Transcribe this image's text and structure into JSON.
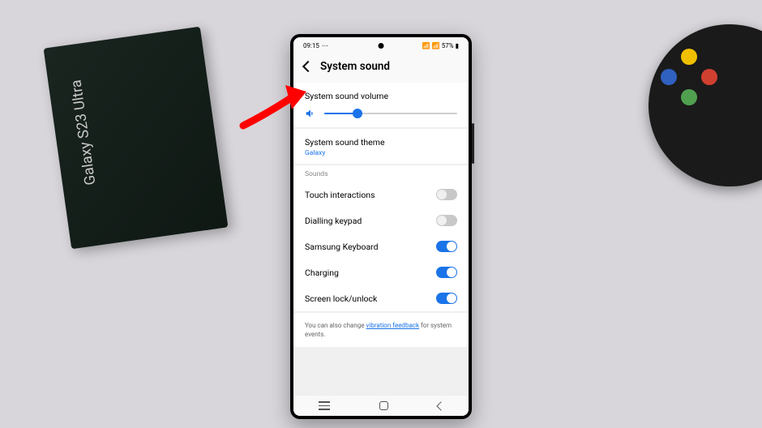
{
  "status_bar": {
    "time": "09:15",
    "battery": "57%"
  },
  "header": {
    "title": "System sound"
  },
  "volume": {
    "label": "System sound volume",
    "percent": 25
  },
  "theme": {
    "label": "System sound theme",
    "value": "Galaxy"
  },
  "sounds_header": "Sounds",
  "toggles": [
    {
      "label": "Touch interactions",
      "on": false
    },
    {
      "label": "Dialling keypad",
      "on": false
    },
    {
      "label": "Samsung Keyboard",
      "on": true
    },
    {
      "label": "Charging",
      "on": true
    },
    {
      "label": "Screen lock/unlock",
      "on": true
    }
  ],
  "footer": {
    "prefix": "You can also change ",
    "link": "vibration feedback",
    "suffix": " for system events."
  },
  "box_label": "Galaxy S23 Ultra"
}
